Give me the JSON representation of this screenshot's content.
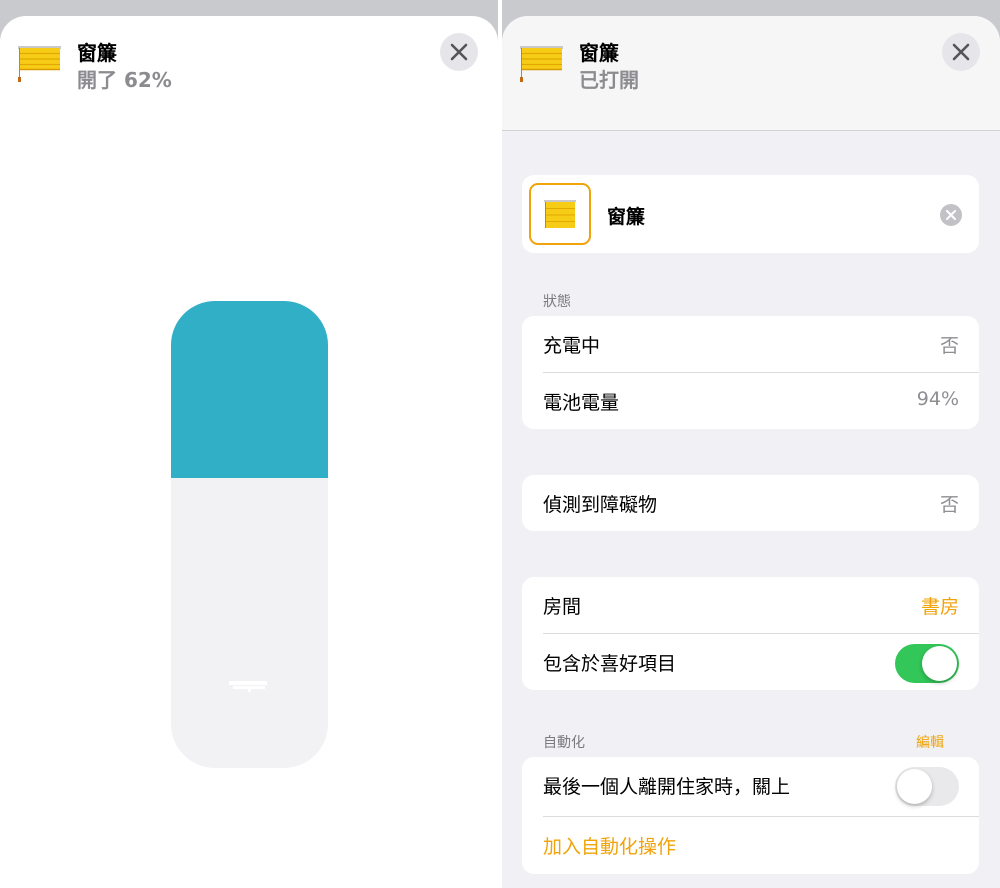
{
  "left_panel": {
    "header": {
      "title": "窗簾",
      "subtitle": "開了 62%"
    },
    "slider": {
      "open_percent": 62,
      "fill_color": "#31afc7"
    }
  },
  "right_panel": {
    "header": {
      "title": "窗簾",
      "subtitle": "已打開"
    },
    "accessory": {
      "name": "窗簾"
    },
    "status": {
      "header": "狀態",
      "rows": [
        {
          "label": "充電中",
          "value": "否"
        },
        {
          "label": "電池電量",
          "value": "94%"
        }
      ]
    },
    "obstruction": {
      "label": "偵測到障礙物",
      "value": "否"
    },
    "room_section": {
      "room": {
        "label": "房間",
        "value": "書房"
      },
      "favorites": {
        "label": "包含於喜好項目",
        "on": true
      }
    },
    "automation": {
      "header": "自動化",
      "edit_label": "編輯",
      "rule": {
        "label": "最後一個人離開住家時，關上",
        "on": false
      },
      "add_label": "加入自動化操作"
    }
  },
  "colors": {
    "accent": "#f0a30a",
    "toggle_on": "#33c659",
    "slider_fill": "#31afc7"
  },
  "icons": [
    "window-blind-icon",
    "close-icon",
    "clear-icon"
  ]
}
